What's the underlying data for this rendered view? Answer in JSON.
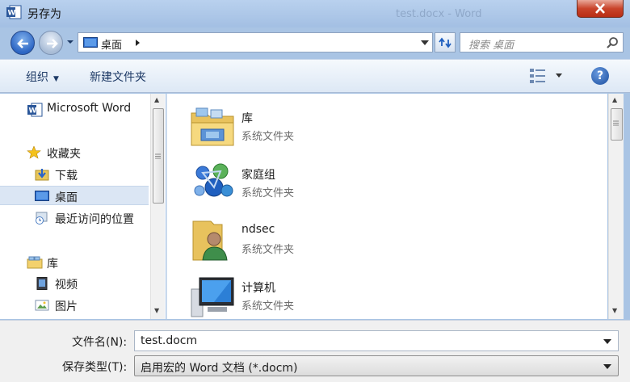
{
  "window": {
    "title": "另存为",
    "background_title": "test.docx - Word"
  },
  "nav": {
    "location": "桌面",
    "search_placeholder": "搜索 桌面"
  },
  "toolbar": {
    "organize": "组织",
    "new_folder": "新建文件夹"
  },
  "sidebar": {
    "items": [
      {
        "label": "Microsoft Word",
        "icon": "word-icon"
      },
      {
        "label": "收藏夹",
        "icon": "star-icon"
      },
      {
        "label": "下载",
        "icon": "download-folder-icon"
      },
      {
        "label": "桌面",
        "icon": "desktop-icon",
        "selected": true
      },
      {
        "label": "最近访问的位置",
        "icon": "recent-places-icon"
      },
      {
        "label": "库",
        "icon": "library-icon"
      },
      {
        "label": "视频",
        "icon": "video-icon"
      },
      {
        "label": "图片",
        "icon": "pictures-icon"
      }
    ]
  },
  "files": [
    {
      "name": "库",
      "type": "系统文件夹",
      "icon": "library-folder-icon"
    },
    {
      "name": "家庭组",
      "type": "系统文件夹",
      "icon": "homegroup-icon"
    },
    {
      "name": "ndsec",
      "type": "系统文件夹",
      "icon": "user-folder-icon"
    },
    {
      "name": "计算机",
      "type": "系统文件夹",
      "icon": "computer-icon"
    }
  ],
  "form": {
    "filename_label": "文件名(N):",
    "filename_value": "test.docm",
    "filetype_label": "保存类型(T):",
    "filetype_value": "启用宏的 Word 文档 (*.docm)"
  },
  "colors": {
    "titlebar": "#a9c4e4",
    "selection": "#dbe6f4",
    "close": "#c9442b",
    "link_text": "#1e3a66"
  }
}
